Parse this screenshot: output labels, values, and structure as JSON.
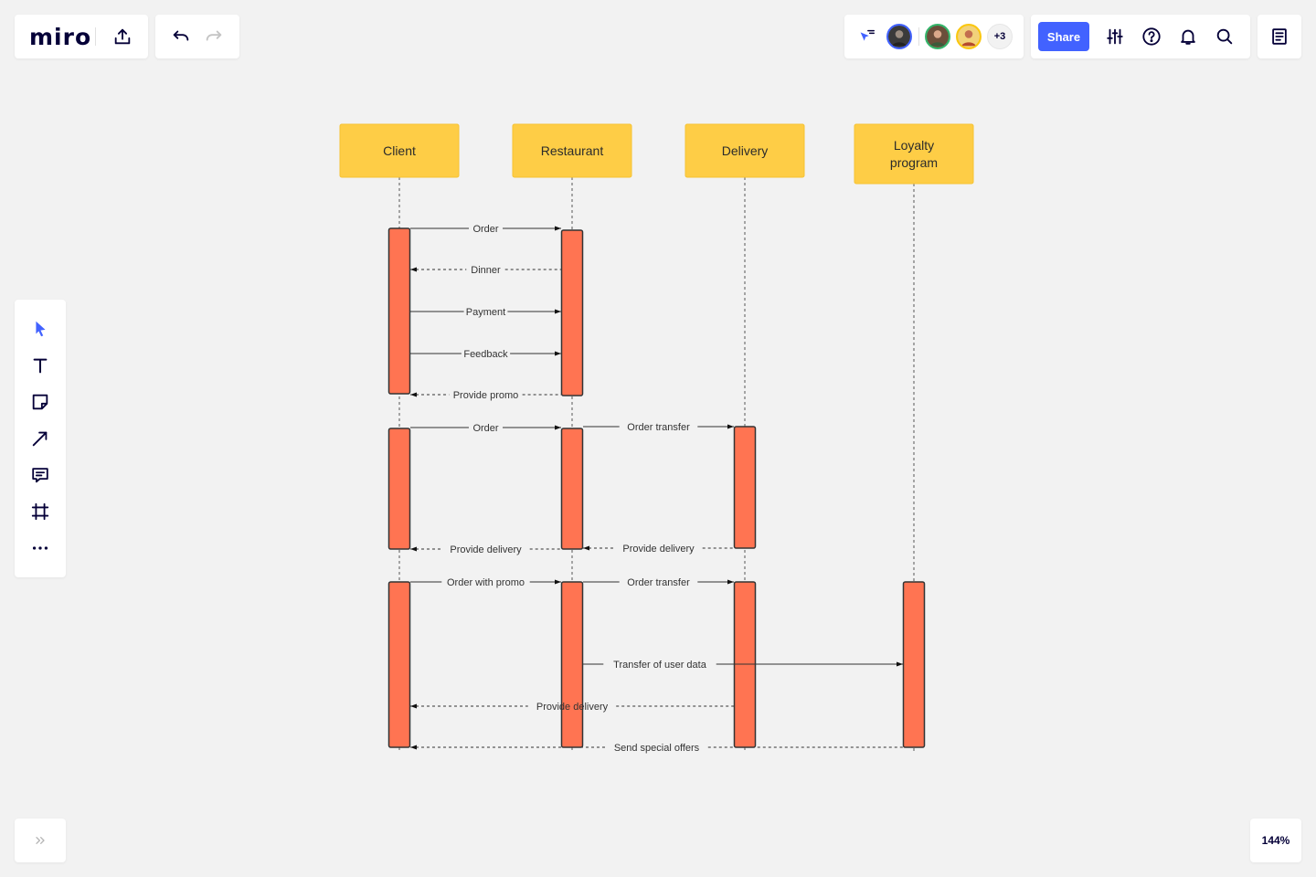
{
  "app": {
    "logo": "miro"
  },
  "collaborators": {
    "extra_count": "+3"
  },
  "toolbar": {
    "share_label": "Share"
  },
  "footer": {
    "zoom": "144%"
  },
  "accent_color": "#4262ff",
  "diagram": {
    "actors": [
      {
        "id": "client",
        "lines": [
          "Client"
        ]
      },
      {
        "id": "restaurant",
        "lines": [
          "Restaurant"
        ]
      },
      {
        "id": "delivery",
        "lines": [
          "Delivery"
        ]
      },
      {
        "id": "loyalty",
        "lines": [
          "Loyalty",
          "program"
        ]
      }
    ],
    "messages": [
      {
        "from": "client",
        "to": "restaurant",
        "label": "Order",
        "dashed": false
      },
      {
        "from": "restaurant",
        "to": "client",
        "label": "Dinner",
        "dashed": true
      },
      {
        "from": "client",
        "to": "restaurant",
        "label": "Payment",
        "dashed": false
      },
      {
        "from": "client",
        "to": "restaurant",
        "label": "Feedback",
        "dashed": false
      },
      {
        "from": "restaurant",
        "to": "client",
        "label": "Provide promo",
        "dashed": true
      },
      {
        "from": "client",
        "to": "restaurant",
        "label": "Order",
        "dashed": false
      },
      {
        "from": "restaurant",
        "to": "delivery",
        "label": "Order transfer",
        "dashed": false
      },
      {
        "from": "restaurant",
        "to": "client",
        "label": "Provide delivery",
        "dashed": true
      },
      {
        "from": "delivery",
        "to": "restaurant",
        "label": "Provide delivery",
        "dashed": true
      },
      {
        "from": "client",
        "to": "restaurant",
        "label": "Order with promo",
        "dashed": false
      },
      {
        "from": "restaurant",
        "to": "delivery",
        "label": "Order transfer",
        "dashed": false
      },
      {
        "from": "restaurant",
        "to": "loyalty",
        "label": "Transfer of user data",
        "dashed": false
      },
      {
        "from": "delivery",
        "to": "client",
        "label": "Provide delivery",
        "dashed": true
      },
      {
        "from": "loyalty",
        "to": "client",
        "label": "Send special offers",
        "dashed": true
      }
    ]
  },
  "icons": {
    "export": "export-icon",
    "undo": "undo-icon",
    "redo": "redo-icon",
    "cursor_follow": "cursor-follow-icon",
    "settings": "sliders-icon",
    "help": "help-icon",
    "notifications": "bell-icon",
    "search": "search-icon",
    "notes": "notes-icon",
    "select": "select-cursor-icon",
    "text": "text-icon",
    "sticky": "sticky-note-icon",
    "line": "line-arrow-icon",
    "comment": "comment-icon",
    "frame": "frame-icon",
    "more": "more-icon",
    "expand": "expand-chevrons-icon"
  }
}
